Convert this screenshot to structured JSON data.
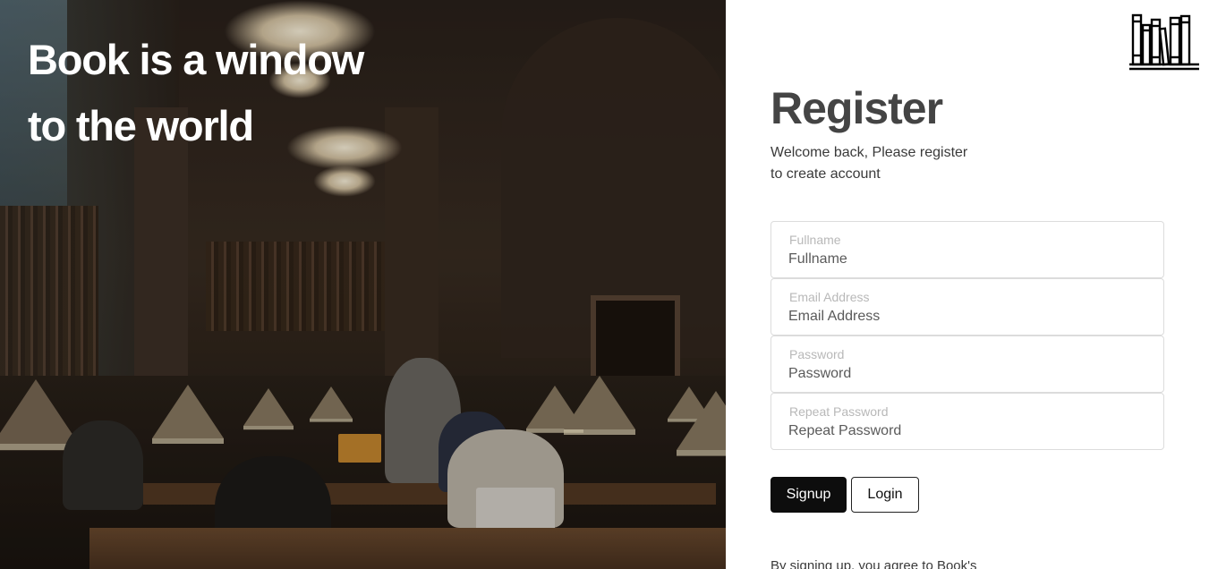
{
  "hero": {
    "title_line1": "Book is a window",
    "title_line2": "to the world"
  },
  "logo": {
    "icon": "bookshelf-icon",
    "color": "#000000"
  },
  "form": {
    "title": "Register",
    "subtitle_line1": "Welcome back, Please register",
    "subtitle_line2": "to create account",
    "fields": [
      {
        "label": "Fullname",
        "placeholder": "Fullname",
        "value": ""
      },
      {
        "label": "Email Address",
        "placeholder": "Email Address",
        "value": ""
      },
      {
        "label": "Password",
        "placeholder": "Password",
        "value": ""
      },
      {
        "label": "Repeat Password",
        "placeholder": "Repeat Password",
        "value": ""
      }
    ],
    "signup_label": "Signup",
    "login_label": "Login",
    "terms_text": "By signing up, you agree to Book's"
  },
  "colors": {
    "primary_button": "#0d0d0d",
    "title": "#444444"
  }
}
